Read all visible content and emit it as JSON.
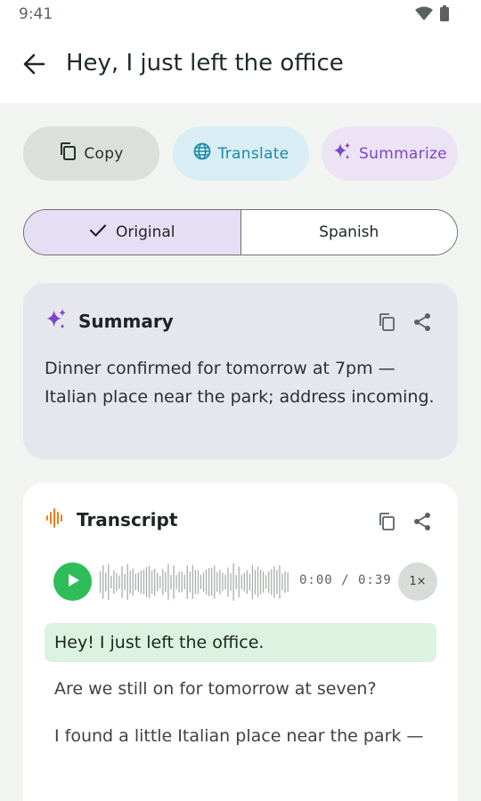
{
  "status": {
    "time": "9:41",
    "icons": [
      "wifi-icon",
      "battery-icon"
    ]
  },
  "header": {
    "title": "Hey, I just left the office",
    "back_icon": "arrow-left-icon"
  },
  "actions": {
    "copy": {
      "label": "Copy",
      "icon": "copy-icon"
    },
    "translate": {
      "label": "Translate",
      "icon": "globe-icon"
    },
    "summarize": {
      "label": "Summarize",
      "icon": "sparkle-icon"
    }
  },
  "language_toggle": {
    "original": {
      "label": "Original",
      "selected": true
    },
    "spanish": {
      "label": "Spanish",
      "selected": false
    }
  },
  "summary": {
    "title": "Summary",
    "text": "Dinner confirmed for tomorrow at 7pm — Italian place near the park; address incoming."
  },
  "transcript": {
    "title": "Transcript",
    "player": {
      "elapsed": "0:00",
      "duration": "0:39",
      "time_display": "0:00 / 0:39",
      "speed": "1×",
      "progress": 0
    },
    "lines": [
      {
        "text": "Hey! I just left the office.",
        "active": true
      },
      {
        "text": "Are we still on for tomorrow at seven?",
        "active": false
      },
      {
        "text": "I found a little Italian place near the park —",
        "active": false
      }
    ]
  },
  "colors": {
    "copy_chip": "#dce0dd",
    "translate_chip": "#d9eef4",
    "translate_text": "#1d8aa6",
    "summarize_chip": "#ece3f5",
    "summarize_text": "#7a48c9",
    "selected_segment": "#e6def5",
    "summary_card": "#e6e6ee",
    "play_button": "#2ebd58",
    "active_line": "#dbf3e0",
    "transcript_icon": "#f07c1c"
  }
}
